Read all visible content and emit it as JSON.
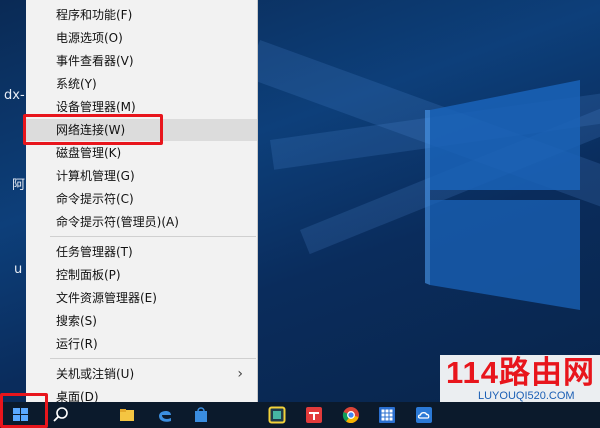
{
  "desktop": {
    "labels": [
      "dx-",
      "阿",
      "u"
    ]
  },
  "menu": {
    "group1": [
      "程序和功能(F)",
      "电源选项(O)",
      "事件查看器(V)",
      "系统(Y)",
      "设备管理器(M)",
      "网络连接(W)",
      "磁盘管理(K)",
      "计算机管理(G)",
      "命令提示符(C)",
      "命令提示符(管理员)(A)"
    ],
    "group2": [
      "任务管理器(T)",
      "控制面板(P)",
      "文件资源管理器(E)",
      "搜索(S)",
      "运行(R)"
    ],
    "group3": [
      "关机或注销(U)",
      "桌面(D)"
    ],
    "highlighted_item": "网络连接(W)",
    "submenu_chevron": "chevron-right-icon"
  },
  "taskbar": {
    "icons": [
      "windows-start-icon",
      "search-icon",
      "file-explorer-icon",
      "edge-icon",
      "store-icon",
      "app-yellow-icon",
      "app-red-icon",
      "chrome-icon",
      "grid-app-icon",
      "cloud-app-icon"
    ]
  },
  "watermark": {
    "title": "114路由网",
    "url": "LUYOUQI520.COM"
  },
  "colors": {
    "highlight_box": "#e8151c",
    "menu_bg": "#f2f2f2",
    "hover_bg": "#dcdcdc",
    "taskbar": "#0b1a2c"
  }
}
